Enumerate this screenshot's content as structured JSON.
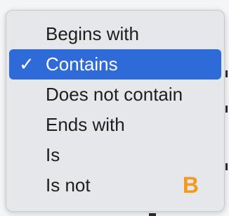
{
  "menu": {
    "items": [
      {
        "label": "Begins with",
        "selected": false
      },
      {
        "label": "Contains",
        "selected": true
      },
      {
        "label": "Does not contain",
        "selected": false
      },
      {
        "label": "Ends with",
        "selected": false
      },
      {
        "label": "Is",
        "selected": false
      },
      {
        "label": "Is not",
        "selected": false
      }
    ],
    "check_glyph": "✓",
    "selected_color": "#2f6bd8"
  },
  "badge": {
    "label": "B",
    "color": "#f39a1e"
  }
}
